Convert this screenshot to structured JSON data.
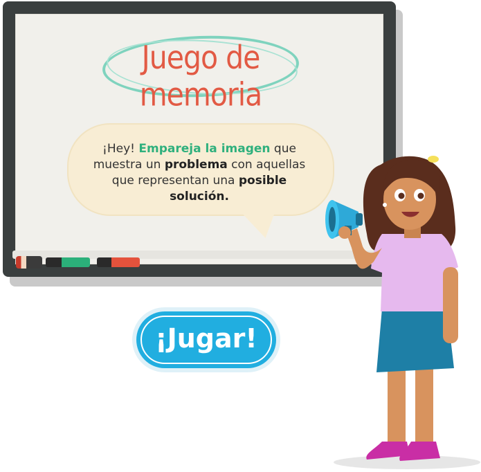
{
  "title": "Juego de memoria",
  "bubble": {
    "part1": "¡Hey! ",
    "highlight": "Empareja la imagen",
    "part2": " que muestra un ",
    "bold1": "problema",
    "part3": " con aquellas que representan una ",
    "bold2": "posible solución."
  },
  "play_button": {
    "label": "¡Jugar!"
  },
  "colors": {
    "title": "#e25a44",
    "accent_green": "#2fb07d",
    "button": "#21aee0",
    "board_frame": "#3a3f3f"
  },
  "icons": [
    "megaphone-icon"
  ]
}
